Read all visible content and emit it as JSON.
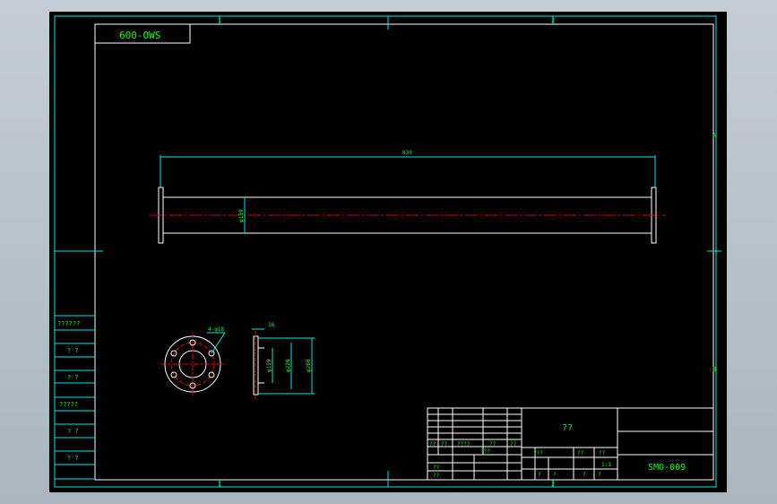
{
  "drawing": {
    "stamp_label": "600-OWS",
    "zone_top_left": "1",
    "zone_top_right": "2",
    "zone_bottom_left": "1",
    "zone_bottom_right": "2",
    "zone_right_top": "A",
    "zone_right_bottom": "B",
    "dim_overall_length": "830",
    "dim_pipe_dia": "φ159",
    "dim_holes": "4-φ18",
    "dim_flange_thk": "16",
    "dim_side_inner": "φ159",
    "dim_side_mid": "φ220",
    "dim_side_outer": "φ260"
  },
  "left_strip": {
    "labels": [
      "??????",
      "? ?",
      "? ?",
      "?????",
      "? ?",
      "? ?"
    ]
  },
  "title_block": {
    "name": "??",
    "drawing_number": "SMO-009",
    "sign_row": [
      "??",
      "??",
      "????",
      "??",
      "??"
    ],
    "left_row1": "??",
    "left_row2": "??",
    "left_col2": "???",
    "scale_header": [
      "???",
      "??",
      "??"
    ],
    "scale_value": "1:1",
    "sheet_row": [
      "?",
      "?",
      "?",
      "?"
    ]
  },
  "colors": {
    "background": "#000000",
    "frame": "#00e5e5",
    "outline": "#ffffff",
    "dimension": "#00ff00",
    "centerline": "#e00000",
    "text": "#00ff00"
  }
}
